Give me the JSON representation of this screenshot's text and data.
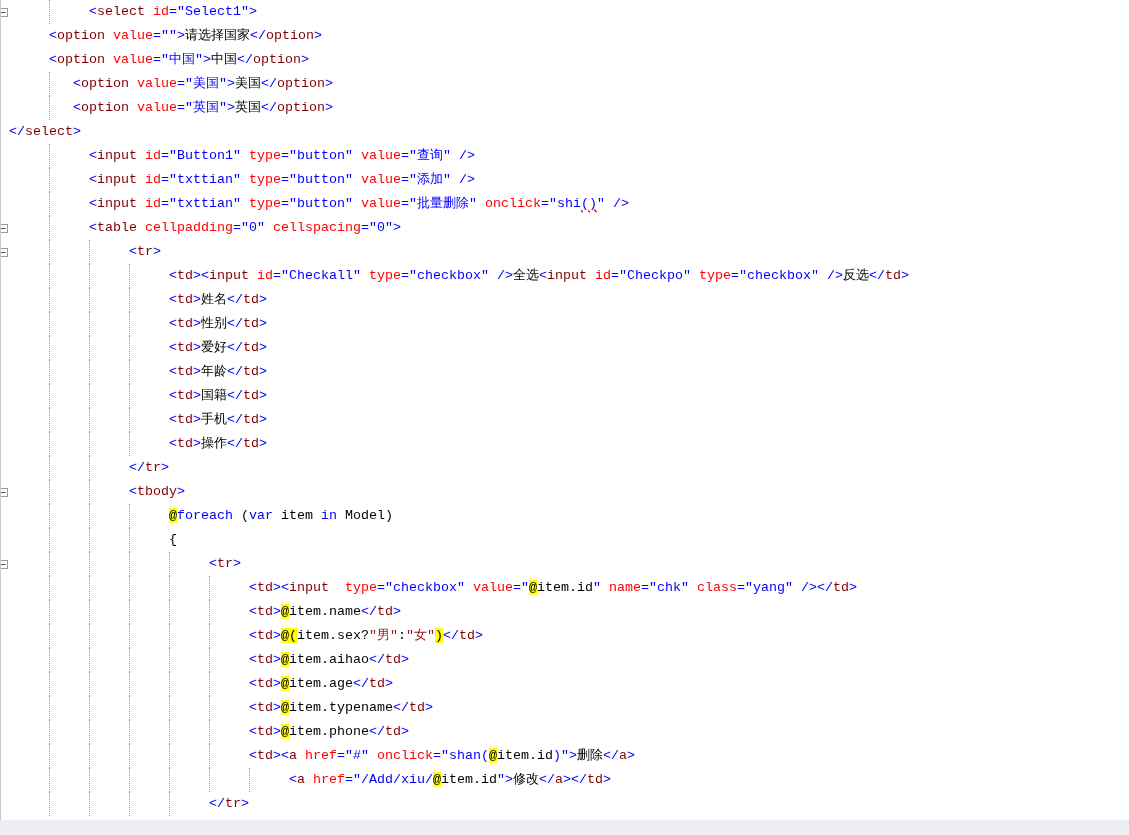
{
  "editor": {
    "lines": [
      {
        "fold": true,
        "tokens": [
          {
            "kind": "punct",
            "text": "          <"
          },
          {
            "kind": "tag",
            "text": "select"
          },
          {
            "kind": "attr",
            "text": " id"
          },
          {
            "kind": "value",
            "text": "=\"Select1\""
          },
          {
            "kind": "punct",
            "text": ">"
          }
        ]
      },
      {
        "fold": false,
        "tokens": [
          {
            "kind": "punct",
            "text": "     <"
          },
          {
            "kind": "tag",
            "text": "option"
          },
          {
            "kind": "attr",
            "text": " value"
          },
          {
            "kind": "value",
            "text": "=\"\""
          },
          {
            "kind": "punct",
            "text": ">"
          },
          {
            "kind": "text",
            "text": "请选择国家"
          },
          {
            "kind": "punct",
            "text": "</"
          },
          {
            "kind": "tag",
            "text": "option"
          },
          {
            "kind": "punct",
            "text": ">"
          }
        ]
      },
      {
        "fold": false,
        "tokens": [
          {
            "kind": "punct",
            "text": "     <"
          },
          {
            "kind": "tag",
            "text": "option"
          },
          {
            "kind": "attr",
            "text": " value"
          },
          {
            "kind": "value",
            "text": "=\"中国\""
          },
          {
            "kind": "punct",
            "text": ">"
          },
          {
            "kind": "text",
            "text": "中国"
          },
          {
            "kind": "punct",
            "text": "</"
          },
          {
            "kind": "tag",
            "text": "option"
          },
          {
            "kind": "punct",
            "text": ">"
          }
        ]
      },
      {
        "fold": false,
        "tokens": [
          {
            "kind": "punct",
            "text": "        <"
          },
          {
            "kind": "tag",
            "text": "option"
          },
          {
            "kind": "attr",
            "text": " value"
          },
          {
            "kind": "value",
            "text": "=\"美国\""
          },
          {
            "kind": "punct",
            "text": ">"
          },
          {
            "kind": "text",
            "text": "美国"
          },
          {
            "kind": "punct",
            "text": "</"
          },
          {
            "kind": "tag",
            "text": "option"
          },
          {
            "kind": "punct",
            "text": ">"
          }
        ]
      },
      {
        "fold": false,
        "tokens": [
          {
            "kind": "punct",
            "text": "        <"
          },
          {
            "kind": "tag",
            "text": "option"
          },
          {
            "kind": "attr",
            "text": " value"
          },
          {
            "kind": "value",
            "text": "=\"英国\""
          },
          {
            "kind": "punct",
            "text": ">"
          },
          {
            "kind": "text",
            "text": "英国"
          },
          {
            "kind": "punct",
            "text": "</"
          },
          {
            "kind": "tag",
            "text": "option"
          },
          {
            "kind": "punct",
            "text": ">"
          }
        ]
      },
      {
        "fold": false,
        "tokens": [
          {
            "kind": "punct",
            "text": "</"
          },
          {
            "kind": "tag",
            "text": "select"
          },
          {
            "kind": "punct",
            "text": ">"
          }
        ]
      },
      {
        "fold": false,
        "tokens": [
          {
            "kind": "punct",
            "text": "          <"
          },
          {
            "kind": "tag",
            "text": "input"
          },
          {
            "kind": "attr",
            "text": " id"
          },
          {
            "kind": "value",
            "text": "=\"Button1\""
          },
          {
            "kind": "attr",
            "text": " type"
          },
          {
            "kind": "value",
            "text": "=\"button\""
          },
          {
            "kind": "attr",
            "text": " value"
          },
          {
            "kind": "value",
            "text": "=\"查询\""
          },
          {
            "kind": "punct",
            "text": " />"
          }
        ]
      },
      {
        "fold": false,
        "tokens": [
          {
            "kind": "punct",
            "text": "          <"
          },
          {
            "kind": "tag",
            "text": "input"
          },
          {
            "kind": "attr",
            "text": " id"
          },
          {
            "kind": "value",
            "text": "=\"txttian\""
          },
          {
            "kind": "attr",
            "text": " type"
          },
          {
            "kind": "value",
            "text": "=\"button\""
          },
          {
            "kind": "attr",
            "text": " value"
          },
          {
            "kind": "value",
            "text": "=\"添加\""
          },
          {
            "kind": "punct",
            "text": " />"
          }
        ]
      },
      {
        "fold": false,
        "tokens": [
          {
            "kind": "punct",
            "text": "          <"
          },
          {
            "kind": "tag",
            "text": "input"
          },
          {
            "kind": "attr",
            "text": " id"
          },
          {
            "kind": "value",
            "text": "=\"txttian\""
          },
          {
            "kind": "attr",
            "text": " type"
          },
          {
            "kind": "value",
            "text": "=\"button\""
          },
          {
            "kind": "attr",
            "text": " value"
          },
          {
            "kind": "value",
            "text": "=\"批量删除\""
          },
          {
            "kind": "attr",
            "text": " onclick"
          },
          {
            "kind": "value",
            "text": "=\"shi"
          },
          {
            "kind": "error",
            "text": "()"
          },
          {
            "kind": "value",
            "text": "\""
          },
          {
            "kind": "punct",
            "text": " />"
          }
        ]
      },
      {
        "fold": true,
        "tokens": [
          {
            "kind": "punct",
            "text": "          <"
          },
          {
            "kind": "tag",
            "text": "table"
          },
          {
            "kind": "attr",
            "text": " cellpadding"
          },
          {
            "kind": "value",
            "text": "=\"0\""
          },
          {
            "kind": "attr",
            "text": " cellspacing"
          },
          {
            "kind": "value",
            "text": "=\"0\""
          },
          {
            "kind": "punct",
            "text": ">"
          }
        ]
      },
      {
        "fold": true,
        "tokens": [
          {
            "kind": "punct",
            "text": "               <"
          },
          {
            "kind": "tag",
            "text": "tr"
          },
          {
            "kind": "punct",
            "text": ">"
          }
        ]
      },
      {
        "fold": false,
        "tokens": [
          {
            "kind": "punct",
            "text": "                    <"
          },
          {
            "kind": "tag",
            "text": "td"
          },
          {
            "kind": "punct",
            "text": "><"
          },
          {
            "kind": "tag",
            "text": "input"
          },
          {
            "kind": "attr",
            "text": " id"
          },
          {
            "kind": "value",
            "text": "=\"Checkall\""
          },
          {
            "kind": "attr",
            "text": " type"
          },
          {
            "kind": "value",
            "text": "=\"checkbox\""
          },
          {
            "kind": "punct",
            "text": " />"
          },
          {
            "kind": "text",
            "text": "全选"
          },
          {
            "kind": "punct",
            "text": "<"
          },
          {
            "kind": "tag",
            "text": "input"
          },
          {
            "kind": "attr",
            "text": " id"
          },
          {
            "kind": "value",
            "text": "=\"Checkpo\""
          },
          {
            "kind": "attr",
            "text": " type"
          },
          {
            "kind": "value",
            "text": "=\"checkbox\""
          },
          {
            "kind": "punct",
            "text": " />"
          },
          {
            "kind": "text",
            "text": "反选"
          },
          {
            "kind": "punct",
            "text": "</"
          },
          {
            "kind": "tag",
            "text": "td"
          },
          {
            "kind": "punct",
            "text": ">"
          }
        ]
      },
      {
        "fold": false,
        "tokens": [
          {
            "kind": "punct",
            "text": "                    <"
          },
          {
            "kind": "tag",
            "text": "td"
          },
          {
            "kind": "punct",
            "text": ">"
          },
          {
            "kind": "text",
            "text": "姓名"
          },
          {
            "kind": "punct",
            "text": "</"
          },
          {
            "kind": "tag",
            "text": "td"
          },
          {
            "kind": "punct",
            "text": ">"
          }
        ]
      },
      {
        "fold": false,
        "tokens": [
          {
            "kind": "punct",
            "text": "                    <"
          },
          {
            "kind": "tag",
            "text": "td"
          },
          {
            "kind": "punct",
            "text": ">"
          },
          {
            "kind": "text",
            "text": "性别"
          },
          {
            "kind": "punct",
            "text": "</"
          },
          {
            "kind": "tag",
            "text": "td"
          },
          {
            "kind": "punct",
            "text": ">"
          }
        ]
      },
      {
        "fold": false,
        "tokens": [
          {
            "kind": "punct",
            "text": "                    <"
          },
          {
            "kind": "tag",
            "text": "td"
          },
          {
            "kind": "punct",
            "text": ">"
          },
          {
            "kind": "text",
            "text": "爱好"
          },
          {
            "kind": "punct",
            "text": "</"
          },
          {
            "kind": "tag",
            "text": "td"
          },
          {
            "kind": "punct",
            "text": ">"
          }
        ]
      },
      {
        "fold": false,
        "tokens": [
          {
            "kind": "punct",
            "text": "                    <"
          },
          {
            "kind": "tag",
            "text": "td"
          },
          {
            "kind": "punct",
            "text": ">"
          },
          {
            "kind": "text",
            "text": "年龄"
          },
          {
            "kind": "punct",
            "text": "</"
          },
          {
            "kind": "tag",
            "text": "td"
          },
          {
            "kind": "punct",
            "text": ">"
          }
        ]
      },
      {
        "fold": false,
        "tokens": [
          {
            "kind": "punct",
            "text": "                    <"
          },
          {
            "kind": "tag",
            "text": "td"
          },
          {
            "kind": "punct",
            "text": ">"
          },
          {
            "kind": "text",
            "text": "国籍"
          },
          {
            "kind": "punct",
            "text": "</"
          },
          {
            "kind": "tag",
            "text": "td"
          },
          {
            "kind": "punct",
            "text": ">"
          }
        ]
      },
      {
        "fold": false,
        "tokens": [
          {
            "kind": "punct",
            "text": "                    <"
          },
          {
            "kind": "tag",
            "text": "td"
          },
          {
            "kind": "punct",
            "text": ">"
          },
          {
            "kind": "text",
            "text": "手机"
          },
          {
            "kind": "punct",
            "text": "</"
          },
          {
            "kind": "tag",
            "text": "td"
          },
          {
            "kind": "punct",
            "text": ">"
          }
        ]
      },
      {
        "fold": false,
        "tokens": [
          {
            "kind": "punct",
            "text": "                    <"
          },
          {
            "kind": "tag",
            "text": "td"
          },
          {
            "kind": "punct",
            "text": ">"
          },
          {
            "kind": "text",
            "text": "操作"
          },
          {
            "kind": "punct",
            "text": "</"
          },
          {
            "kind": "tag",
            "text": "td"
          },
          {
            "kind": "punct",
            "text": ">"
          }
        ]
      },
      {
        "fold": false,
        "tokens": [
          {
            "kind": "punct",
            "text": "               </"
          },
          {
            "kind": "tag",
            "text": "tr"
          },
          {
            "kind": "punct",
            "text": ">"
          }
        ]
      },
      {
        "fold": true,
        "tokens": [
          {
            "kind": "punct",
            "text": "               <"
          },
          {
            "kind": "tag",
            "text": "tbody"
          },
          {
            "kind": "punct",
            "text": ">"
          }
        ]
      },
      {
        "fold": false,
        "tokens": [
          {
            "kind": "razor",
            "text": "                    @"
          },
          {
            "kind": "keyword",
            "text": "foreach"
          },
          {
            "kind": "text",
            "text": " ("
          },
          {
            "kind": "keyword",
            "text": "var"
          },
          {
            "kind": "text",
            "text": " item "
          },
          {
            "kind": "keyword",
            "text": "in"
          },
          {
            "kind": "text",
            "text": " Model)"
          }
        ]
      },
      {
        "fold": false,
        "tokens": [
          {
            "kind": "text",
            "text": "                    {"
          }
        ]
      },
      {
        "fold": true,
        "tokens": [
          {
            "kind": "punct",
            "text": "                         <"
          },
          {
            "kind": "tag",
            "text": "tr"
          },
          {
            "kind": "punct",
            "text": ">"
          }
        ]
      },
      {
        "fold": false,
        "tokens": [
          {
            "kind": "punct",
            "text": "                              <"
          },
          {
            "kind": "tag",
            "text": "td"
          },
          {
            "kind": "punct",
            "text": "><"
          },
          {
            "kind": "tag",
            "text": "input"
          },
          {
            "kind": "attr",
            "text": "  type"
          },
          {
            "kind": "value",
            "text": "=\"checkbox\""
          },
          {
            "kind": "attr",
            "text": " value"
          },
          {
            "kind": "value",
            "text": "=\""
          },
          {
            "kind": "razor",
            "text": "@"
          },
          {
            "kind": "text",
            "text": "item.id"
          },
          {
            "kind": "value",
            "text": "\""
          },
          {
            "kind": "attr",
            "text": " name"
          },
          {
            "kind": "value",
            "text": "=\"chk\""
          },
          {
            "kind": "attr",
            "text": " class"
          },
          {
            "kind": "value",
            "text": "=\"yang\""
          },
          {
            "kind": "punct",
            "text": " /></"
          },
          {
            "kind": "tag",
            "text": "td"
          },
          {
            "kind": "punct",
            "text": ">"
          }
        ]
      },
      {
        "fold": false,
        "tokens": [
          {
            "kind": "punct",
            "text": "                              <"
          },
          {
            "kind": "tag",
            "text": "td"
          },
          {
            "kind": "punct",
            "text": ">"
          },
          {
            "kind": "razor",
            "text": "@"
          },
          {
            "kind": "text",
            "text": "item.name"
          },
          {
            "kind": "punct",
            "text": "</"
          },
          {
            "kind": "tag",
            "text": "td"
          },
          {
            "kind": "punct",
            "text": ">"
          }
        ]
      },
      {
        "fold": false,
        "tokens": [
          {
            "kind": "punct",
            "text": "                              <"
          },
          {
            "kind": "tag",
            "text": "td"
          },
          {
            "kind": "punct",
            "text": ">"
          },
          {
            "kind": "razor",
            "text": "@("
          },
          {
            "kind": "text",
            "text": "item.sex?"
          },
          {
            "kind": "string",
            "text": "\"男\""
          },
          {
            "kind": "text",
            "text": ":"
          },
          {
            "kind": "string",
            "text": "\"女\""
          },
          {
            "kind": "razor",
            "text": ")"
          },
          {
            "kind": "punct",
            "text": "</"
          },
          {
            "kind": "tag",
            "text": "td"
          },
          {
            "kind": "punct",
            "text": ">"
          }
        ]
      },
      {
        "fold": false,
        "tokens": [
          {
            "kind": "punct",
            "text": "                              <"
          },
          {
            "kind": "tag",
            "text": "td"
          },
          {
            "kind": "punct",
            "text": ">"
          },
          {
            "kind": "razor",
            "text": "@"
          },
          {
            "kind": "text",
            "text": "item.aihao"
          },
          {
            "kind": "punct",
            "text": "</"
          },
          {
            "kind": "tag",
            "text": "td"
          },
          {
            "kind": "punct",
            "text": ">"
          }
        ]
      },
      {
        "fold": false,
        "tokens": [
          {
            "kind": "punct",
            "text": "                              <"
          },
          {
            "kind": "tag",
            "text": "td"
          },
          {
            "kind": "punct",
            "text": ">"
          },
          {
            "kind": "razor",
            "text": "@"
          },
          {
            "kind": "text",
            "text": "item.age"
          },
          {
            "kind": "punct",
            "text": "</"
          },
          {
            "kind": "tag",
            "text": "td"
          },
          {
            "kind": "punct",
            "text": ">"
          }
        ]
      },
      {
        "fold": false,
        "tokens": [
          {
            "kind": "punct",
            "text": "                              <"
          },
          {
            "kind": "tag",
            "text": "td"
          },
          {
            "kind": "punct",
            "text": ">"
          },
          {
            "kind": "razor",
            "text": "@"
          },
          {
            "kind": "text",
            "text": "item.typename"
          },
          {
            "kind": "punct",
            "text": "</"
          },
          {
            "kind": "tag",
            "text": "td"
          },
          {
            "kind": "punct",
            "text": ">"
          }
        ]
      },
      {
        "fold": false,
        "tokens": [
          {
            "kind": "punct",
            "text": "                              <"
          },
          {
            "kind": "tag",
            "text": "td"
          },
          {
            "kind": "punct",
            "text": ">"
          },
          {
            "kind": "razor",
            "text": "@"
          },
          {
            "kind": "text",
            "text": "item.phone"
          },
          {
            "kind": "punct",
            "text": "</"
          },
          {
            "kind": "tag",
            "text": "td"
          },
          {
            "kind": "punct",
            "text": ">"
          }
        ]
      },
      {
        "fold": false,
        "tokens": [
          {
            "kind": "punct",
            "text": "                              <"
          },
          {
            "kind": "tag",
            "text": "td"
          },
          {
            "kind": "punct",
            "text": "><"
          },
          {
            "kind": "tag",
            "text": "a"
          },
          {
            "kind": "attr",
            "text": " href"
          },
          {
            "kind": "value",
            "text": "=\"#\""
          },
          {
            "kind": "attr",
            "text": " onclick"
          },
          {
            "kind": "value",
            "text": "=\"shan("
          },
          {
            "kind": "razor",
            "text": "@"
          },
          {
            "kind": "text",
            "text": "item.id"
          },
          {
            "kind": "value",
            "text": ")\""
          },
          {
            "kind": "punct",
            "text": ">"
          },
          {
            "kind": "text",
            "text": "删除"
          },
          {
            "kind": "punct",
            "text": "</"
          },
          {
            "kind": "tag",
            "text": "a"
          },
          {
            "kind": "punct",
            "text": ">"
          }
        ]
      },
      {
        "fold": false,
        "tokens": [
          {
            "kind": "punct",
            "text": "                                   <"
          },
          {
            "kind": "tag",
            "text": "a"
          },
          {
            "kind": "attr",
            "text": " href"
          },
          {
            "kind": "value",
            "text": "=\"/Add/xiu/"
          },
          {
            "kind": "razor",
            "text": "@"
          },
          {
            "kind": "text",
            "text": "item.id"
          },
          {
            "kind": "value",
            "text": "\""
          },
          {
            "kind": "punct",
            "text": ">"
          },
          {
            "kind": "text",
            "text": "修改"
          },
          {
            "kind": "punct",
            "text": "</"
          },
          {
            "kind": "tag",
            "text": "a"
          },
          {
            "kind": "punct",
            "text": "></"
          },
          {
            "kind": "tag",
            "text": "td"
          },
          {
            "kind": "punct",
            "text": ">"
          }
        ]
      },
      {
        "fold": false,
        "tokens": [
          {
            "kind": "punct",
            "text": "                         </"
          },
          {
            "kind": "tag",
            "text": "tr"
          },
          {
            "kind": "punct",
            "text": ">"
          }
        ]
      }
    ]
  }
}
